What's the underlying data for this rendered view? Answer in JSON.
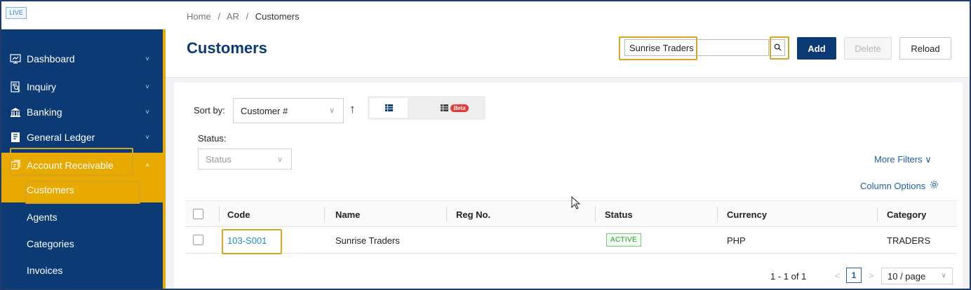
{
  "env_badge": "LIVE",
  "sidebar": {
    "items": [
      {
        "label": "Dashboard",
        "icon": "dashboard-icon",
        "chevron": "˅"
      },
      {
        "label": "Inquiry",
        "icon": "inquiry-icon",
        "chevron": "˅"
      },
      {
        "label": "Banking",
        "icon": "bank-icon",
        "chevron": "˅"
      },
      {
        "label": "General Ledger",
        "icon": "ledger-icon",
        "chevron": "˅"
      },
      {
        "label": "Account Receivable",
        "icon": "receivable-icon",
        "chevron": "˄"
      }
    ],
    "subitems": [
      {
        "label": "Customers"
      },
      {
        "label": "Agents"
      },
      {
        "label": "Categories"
      },
      {
        "label": "Invoices"
      }
    ]
  },
  "breadcrumb": {
    "home": "Home",
    "sep": "/",
    "section": "AR",
    "current": "Customers"
  },
  "page_title": "Customers",
  "search": {
    "value": "Sunrise Traders",
    "icon": "search-icon"
  },
  "toolbar": {
    "add_label": "Add",
    "delete_label": "Delete",
    "reload_label": "Reload"
  },
  "sort": {
    "label": "Sort by:",
    "value": "Customer #",
    "direction": "↑"
  },
  "view": {
    "beta_label": "Beta"
  },
  "status_filter": {
    "label": "Status:",
    "placeholder": "Status"
  },
  "more_filters": "More Filters",
  "column_options": "Column Options",
  "table": {
    "headers": [
      "Code",
      "Name",
      "Reg No.",
      "Status",
      "Currency",
      "Category"
    ],
    "rows": [
      {
        "code": "103-S001",
        "name": "Sunrise Traders",
        "reg_no": "",
        "status": "ACTIVE",
        "currency": "PHP",
        "category": "TRADERS"
      }
    ]
  },
  "pagination": {
    "range": "1 - 1 of 1",
    "current_page": "1",
    "page_size": "10 / page"
  },
  "colors": {
    "sidebar": "#0b3a75",
    "accent": "#e8a900",
    "primary": "#0b3a75",
    "link": "#1f8ad1",
    "active_status": "#2e9a2e"
  }
}
